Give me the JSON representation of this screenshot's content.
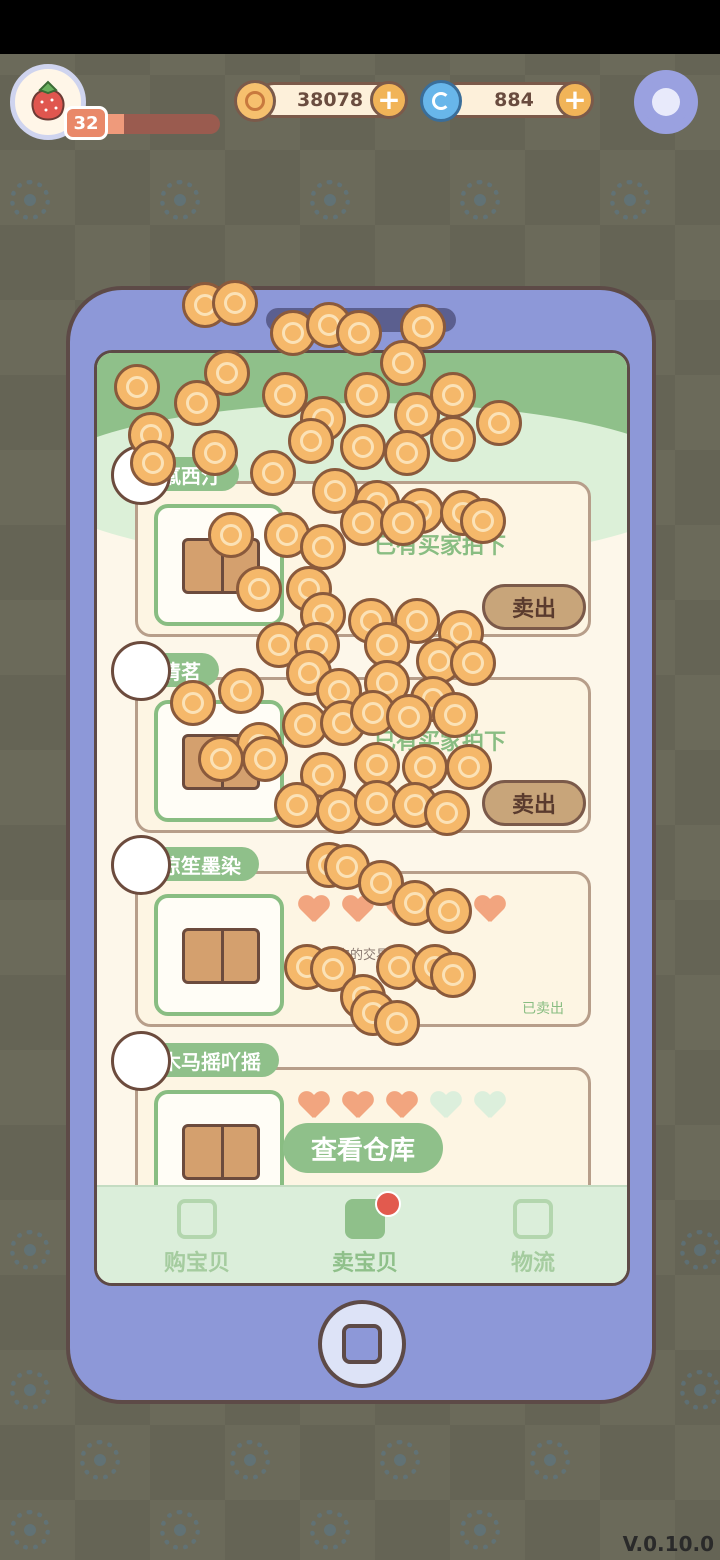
{
  "hud": {
    "level": "32",
    "xp_fraction": 0.25,
    "coins": "38078",
    "gems": "884",
    "plus_symbol": "+"
  },
  "listings": [
    {
      "seller": "氟西汀",
      "status": "已有买家拍下",
      "action": "卖出"
    },
    {
      "seller": "清茗",
      "status": "已有买家拍下",
      "action": "卖出"
    },
    {
      "seller": "凉笙墨染",
      "message": "期待下次的交易啦~",
      "sold_label": "已卖出",
      "hearts": 5
    },
    {
      "seller": "木马摇吖摇",
      "hearts_filled": 3,
      "hearts_total": 5
    }
  ],
  "warehouse_button": "查看仓库",
  "tabs": [
    {
      "label": "购宝贝",
      "icon": "shopping-bag-icon"
    },
    {
      "label": "卖宝贝",
      "icon": "price-tag-icon"
    },
    {
      "label": "物流",
      "icon": "package-icon"
    }
  ],
  "version": "V.0.10.0"
}
